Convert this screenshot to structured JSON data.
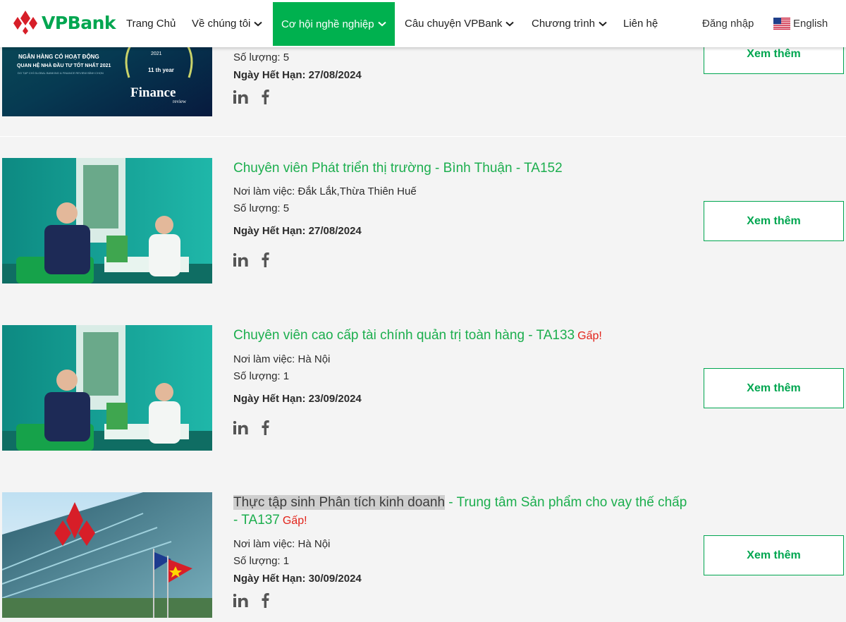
{
  "nav": {
    "brand": "VPBank",
    "items": [
      {
        "label": "Trang Chủ"
      },
      {
        "label": "Về chúng tôi"
      },
      {
        "label": "Cơ hội nghề nghiệp"
      },
      {
        "label": "Câu chuyện VPBank"
      },
      {
        "label": "Chương trình"
      },
      {
        "label": "Liên hệ"
      }
    ],
    "login": "Đăng nhập",
    "language": "English"
  },
  "jobs": [
    {
      "title": "",
      "location": "",
      "quantity": "Số lượng: 5",
      "deadline": "Ngày Hết Hạn: 27/08/2024",
      "button": "Xem thêm",
      "image_text": {
        "line1": "NGÂN HÀNG CÓ HOẠT ĐỘNG",
        "line2": "QUAN HỆ NHÀ ĐẦU TƯ TỐT NHẤT 2021",
        "line3": "DO TẠP CHÍ GLOBAL BANKING & FINANCE REVIEW BÌNH CHỌN",
        "award_year": "2021",
        "award_rank": "11 th year",
        "award_mag": "Finance",
        "award_sub": "review"
      }
    },
    {
      "title": "Chuyên viên Phát triển thị trường - Bình Thuận - TA152",
      "location": "Nơi làm việc: Đắk Lắk,Thừa Thiên Huế",
      "quantity": "Số lượng: 5",
      "deadline": "Ngày Hết Hạn: 27/08/2024",
      "button": "Xem thêm"
    },
    {
      "title": "Chuyên viên cao cấp tài chính quản trị toàn hàng - TA133",
      "urgent": "Gấp!",
      "location": "Nơi làm việc: Hà Nội",
      "quantity": "Số lượng: 1",
      "deadline": "Ngày Hết Hạn: 23/09/2024",
      "button": "Xem thêm"
    },
    {
      "title_highlight": "Thực tập sinh Phân tích kinh doanh",
      "title_rest": " - Trung tâm Sản phẩm cho vay thế chấp - TA137",
      "urgent": "Gấp!",
      "location": "Nơi làm việc: Hà Nội",
      "quantity": "Số lượng: 1",
      "deadline": "Ngày Hết Hạn: 30/09/2024",
      "button": "Xem thêm"
    }
  ],
  "colors": {
    "brand_green": "#00a650",
    "nav_active": "#00b14f",
    "title_green": "#1cae4e",
    "urgent_red": "#e2231a",
    "card_bg": "#f4f4f4",
    "social_icon": "#555555"
  },
  "icons": [
    "vpbank-logo-icon",
    "chevron-down-icon",
    "us-flag-icon",
    "linkedin-icon",
    "facebook-icon"
  ]
}
